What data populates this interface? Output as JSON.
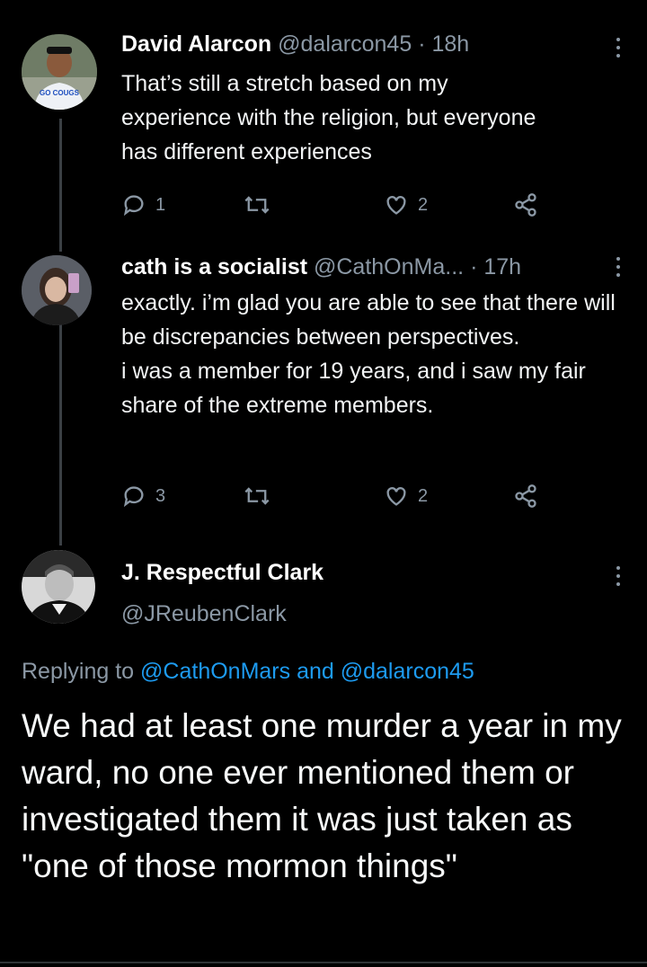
{
  "tweets": [
    {
      "name": "David Alarcon",
      "handle": "@dalarcon45",
      "separator": "·",
      "time": "18h",
      "text": "That’s still a stretch based on my experience with the religion, but everyone has different experiences",
      "replies": "1",
      "likes": "2",
      "avatar_text": "GO COUGS"
    },
    {
      "name": "cath is a socialist",
      "handle": "@CathOnMa...",
      "separator": "·",
      "time": "17h",
      "text_line1": "exactly. i’m glad you are able to see that there will be discrepancies between perspectives.",
      "text_line2": "i was a member for 19 years, and i saw my fair share of the extreme members.",
      "replies": "3",
      "likes": "2"
    }
  ],
  "focus_tweet": {
    "name": "J. Respectful Clark",
    "handle": "@JReubenClark",
    "replying_prefix": "Replying to",
    "reply_to_1": "@CathOnMars",
    "reply_and": "and",
    "reply_to_2": "@dalarcon45",
    "text": "We had at least one murder a year in my ward, no one ever mentioned them or investigated them it was just taken as \"one of those mormon things\""
  },
  "icons": [
    "reply-icon",
    "retweet-icon",
    "like-icon",
    "share-icon",
    "more-icon"
  ],
  "colors": {
    "background": "#000000",
    "secondary_text": "#8b98a5",
    "link": "#1d9bf0",
    "thread_line": "#3a3f44"
  }
}
